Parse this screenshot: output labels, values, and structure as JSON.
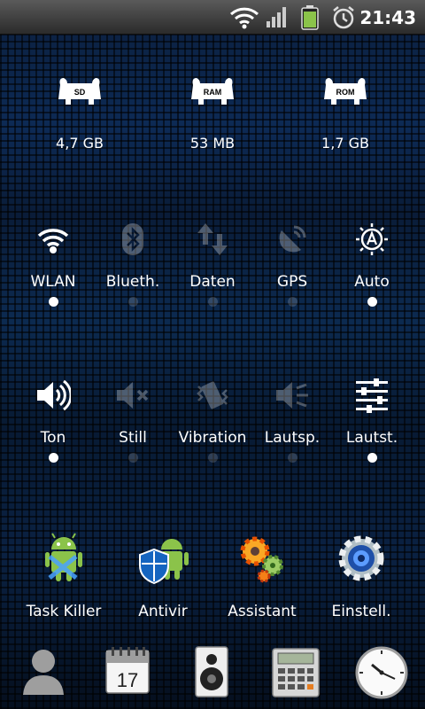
{
  "status_bar": {
    "time": "21:43",
    "icons": [
      "wifi-icon",
      "signal-icon",
      "battery-icon",
      "alarm-icon"
    ],
    "battery_color": "#8bc34a"
  },
  "storage": [
    {
      "badge": "SD",
      "value": "4,7 GB"
    },
    {
      "badge": "RAM",
      "value": "53 MB"
    },
    {
      "badge": "ROM",
      "value": "1,7 GB"
    }
  ],
  "toggles_row1": [
    {
      "label": "WLAN",
      "icon": "wifi-icon",
      "on": true
    },
    {
      "label": "Blueth.",
      "icon": "bluetooth-icon",
      "on": false
    },
    {
      "label": "Daten",
      "icon": "data-arrows-icon",
      "on": false
    },
    {
      "label": "GPS",
      "icon": "gps-icon",
      "on": false
    },
    {
      "label": "Auto",
      "icon": "auto-brightness-icon",
      "on": true
    }
  ],
  "toggles_row2": [
    {
      "label": "Ton",
      "icon": "speaker-icon",
      "on": true
    },
    {
      "label": "Still",
      "icon": "mute-icon",
      "on": false
    },
    {
      "label": "Vibration",
      "icon": "vibration-icon",
      "on": false
    },
    {
      "label": "Lautsp.",
      "icon": "loudspeaker-icon",
      "on": false
    },
    {
      "label": "Lautst.",
      "icon": "volume-sliders-icon",
      "on": true
    }
  ],
  "apps": [
    {
      "label": "Task Killer",
      "icon": "task-killer-android-icon"
    },
    {
      "label": "Antivir",
      "icon": "antivir-shield-android-icon"
    },
    {
      "label": "Assistant",
      "icon": "assistant-gears-icon"
    },
    {
      "label": "Einstell.",
      "icon": "settings-gear-icon"
    }
  ],
  "dock": {
    "contacts": "contacts-icon",
    "calendar": {
      "icon": "calendar-icon",
      "day": "17"
    },
    "music": "music-speaker-icon",
    "calculator": "calculator-icon",
    "clock": "clock-icon"
  },
  "colors": {
    "accent_green": "#8bc34a",
    "dot_on": "#ffffff"
  }
}
